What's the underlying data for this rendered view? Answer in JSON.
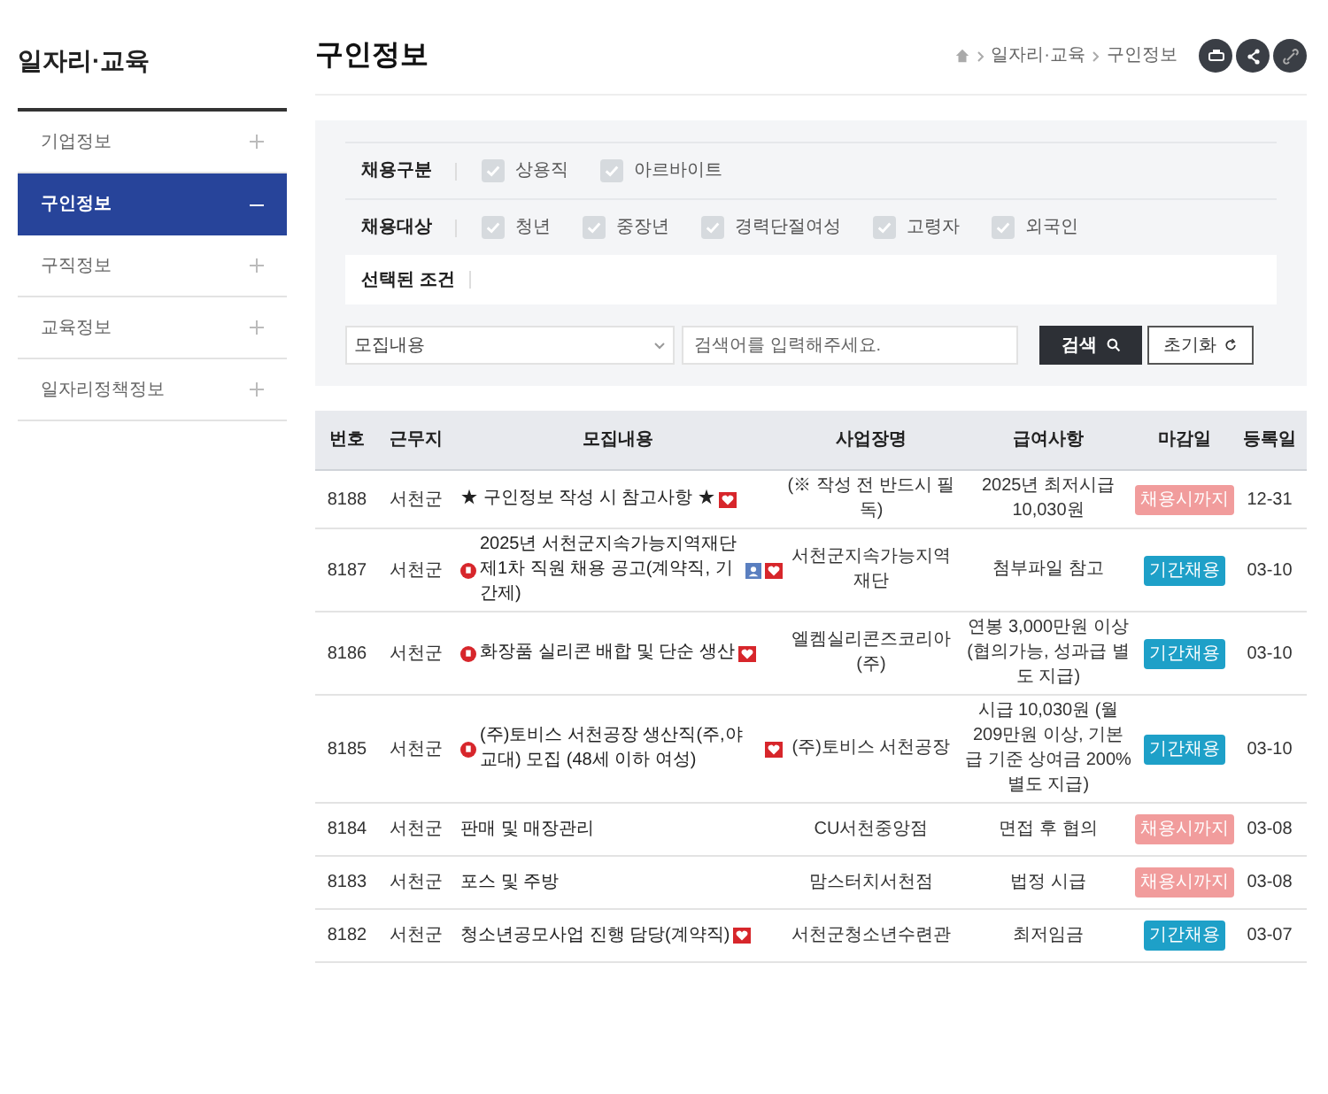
{
  "sidebar": {
    "title": "일자리·교육",
    "items": [
      {
        "label": "기업정보",
        "selected": false
      },
      {
        "label": "구인정보",
        "selected": true
      },
      {
        "label": "구직정보",
        "selected": false
      },
      {
        "label": "교육정보",
        "selected": false
      },
      {
        "label": "일자리정책정보",
        "selected": false
      }
    ]
  },
  "page_title": "구인정보",
  "breadcrumb": [
    "일자리·교육",
    "구인정보"
  ],
  "filters": {
    "groups": [
      {
        "label": "채용구분",
        "options": [
          {
            "label": "상용직",
            "checked": true
          },
          {
            "label": "아르바이트",
            "checked": true
          }
        ]
      },
      {
        "label": "채용대상",
        "options": [
          {
            "label": "청년",
            "checked": true
          },
          {
            "label": "중장년",
            "checked": true
          },
          {
            "label": "경력단절여성",
            "checked": true
          },
          {
            "label": "고령자",
            "checked": true
          },
          {
            "label": "외국인",
            "checked": true
          }
        ]
      }
    ],
    "selected_label": "선택된 조건",
    "select_value": "모집내용",
    "search_placeholder": "검색어를 입력해주세요.",
    "search_button": "검색",
    "reset_button": "초기화"
  },
  "table": {
    "columns": [
      "번호",
      "근무지",
      "모집내용",
      "사업장명",
      "급여사항",
      "마감일",
      "등록일"
    ],
    "rows": [
      {
        "number": "8188",
        "location": "서천군",
        "title": "★ 구인정보 작성 시 참고사항 ★",
        "pinned": false,
        "person": false,
        "heart": true,
        "company": "(※ 작성 전 반드시 필독)",
        "salary": "2025년 최저시급 10,030원",
        "status": {
          "label": "채용시까지",
          "kind": "until"
        },
        "date": "12-31"
      },
      {
        "number": "8187",
        "location": "서천군",
        "title": "2025년 서천군지속가능지역재단 제1차 직원 채용 공고(계약직, 기간제)",
        "pinned": true,
        "person": true,
        "heart": true,
        "company": "서천군지속가능지역재단",
        "salary": "첨부파일 참고",
        "status": {
          "label": "기간채용",
          "kind": "period"
        },
        "date": "03-10"
      },
      {
        "number": "8186",
        "location": "서천군",
        "title": "화장품 실리콘 배합 및 단순 생산",
        "pinned": true,
        "person": false,
        "heart": true,
        "company": "엘켐실리콘즈코리아(주)",
        "salary": "연봉 3,000만원 이상 (협의가능, 성과급 별도 지급)",
        "status": {
          "label": "기간채용",
          "kind": "period"
        },
        "date": "03-10"
      },
      {
        "number": "8185",
        "location": "서천군",
        "title": "(주)토비스 서천공장 생산직(주,야 교대) 모집 (48세 이하 여성)",
        "pinned": true,
        "person": false,
        "heart": true,
        "company": "(주)토비스 서천공장",
        "salary": "시급 10,030원 (월 209만원 이상, 기본급 기준 상여금 200% 별도 지급)",
        "status": {
          "label": "기간채용",
          "kind": "period"
        },
        "date": "03-10"
      },
      {
        "number": "8184",
        "location": "서천군",
        "title": "판매 및 매장관리",
        "pinned": false,
        "person": false,
        "heart": false,
        "company": "CU서천중앙점",
        "salary": "면접 후 협의",
        "status": {
          "label": "채용시까지",
          "kind": "until"
        },
        "date": "03-08"
      },
      {
        "number": "8183",
        "location": "서천군",
        "title": "포스 및 주방",
        "pinned": false,
        "person": false,
        "heart": false,
        "company": "맘스터치서천점",
        "salary": "법정 시급",
        "status": {
          "label": "채용시까지",
          "kind": "until"
        },
        "date": "03-08"
      },
      {
        "number": "8182",
        "location": "서천군",
        "title": "청소년공모사업 진행 담당(계약직)",
        "pinned": false,
        "person": false,
        "heart": true,
        "company": "서천군청소년수련관",
        "salary": "최저임금",
        "status": {
          "label": "기간채용",
          "kind": "period"
        },
        "date": "03-07"
      }
    ]
  }
}
